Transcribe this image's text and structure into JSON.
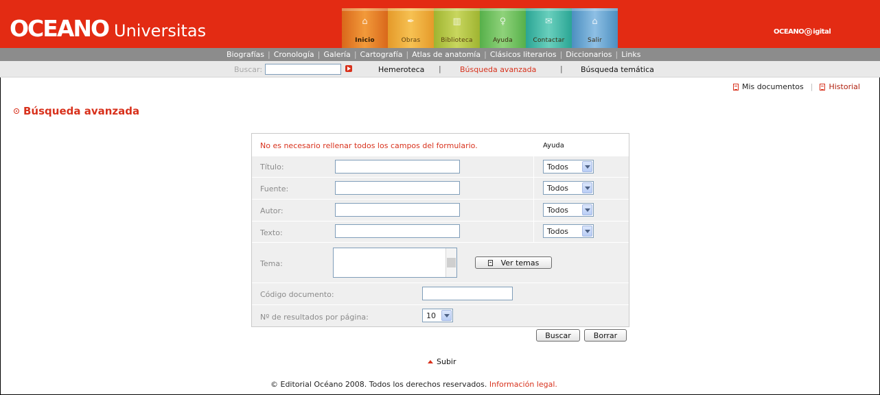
{
  "header": {
    "logo_main": "OCEANO",
    "logo_sub": "Universitas",
    "brand_right_prefix": "OCEANO",
    "brand_right_d": "D",
    "brand_right_suffix": "igital",
    "nav": [
      {
        "label": "Inicio",
        "icon": "home-icon",
        "glyph": "⌂"
      },
      {
        "label": "Obras",
        "icon": "quill-icon",
        "glyph": "✒"
      },
      {
        "label": "Biblioteca",
        "icon": "books-icon",
        "glyph": "▥"
      },
      {
        "label": "Ayuda",
        "icon": "lightbulb-icon",
        "glyph": "♀"
      },
      {
        "label": "Contactar",
        "icon": "mail-icon",
        "glyph": "✉"
      },
      {
        "label": "Salir",
        "icon": "lock-icon",
        "glyph": "⌂"
      }
    ]
  },
  "subnav": {
    "items": [
      "Biografías",
      "Cronología",
      "Galería",
      "Cartografía",
      "Atlas de anatomía",
      "Clásicos literarios",
      "Diccionarios",
      "Links"
    ],
    "separator": "|"
  },
  "searchbar": {
    "label": "Buscar:",
    "value": "",
    "links": [
      "Hemeroteca",
      "Búsqueda avanzada",
      "Búsqueda temática"
    ],
    "separator": "|"
  },
  "userlinks": {
    "docs": "Mis documentos",
    "history": "Historial",
    "separator": "|"
  },
  "page_title": "Búsqueda avanzada",
  "form": {
    "note": "No es necesario rellenar todos los campos del formulario.",
    "help": "Ayuda",
    "fields": [
      {
        "label": "Título:",
        "value": "",
        "scope": "Todos"
      },
      {
        "label": "Fuente:",
        "value": "",
        "scope": "Todos"
      },
      {
        "label": "Autor:",
        "value": "",
        "scope": "Todos"
      },
      {
        "label": "Texto:",
        "value": "",
        "scope": "Todos"
      }
    ],
    "tema_label": "Tema:",
    "tema_button": "Ver temas",
    "codigo_label": "Código documento:",
    "codigo_value": "",
    "results_label": "Nº de resultados por página:",
    "results_value": "10",
    "search_button": "Buscar",
    "clear_button": "Borrar"
  },
  "footer": {
    "up": "Subir",
    "copyright": "© Editorial Océano 2008. Todos los derechos reservados.",
    "legal": "Información legal."
  },
  "colors": {
    "brand_red": "#e32b13",
    "accent_red": "#d8311c",
    "subnav_gray": "#8c8c8c",
    "form_gray": "#efefef"
  }
}
